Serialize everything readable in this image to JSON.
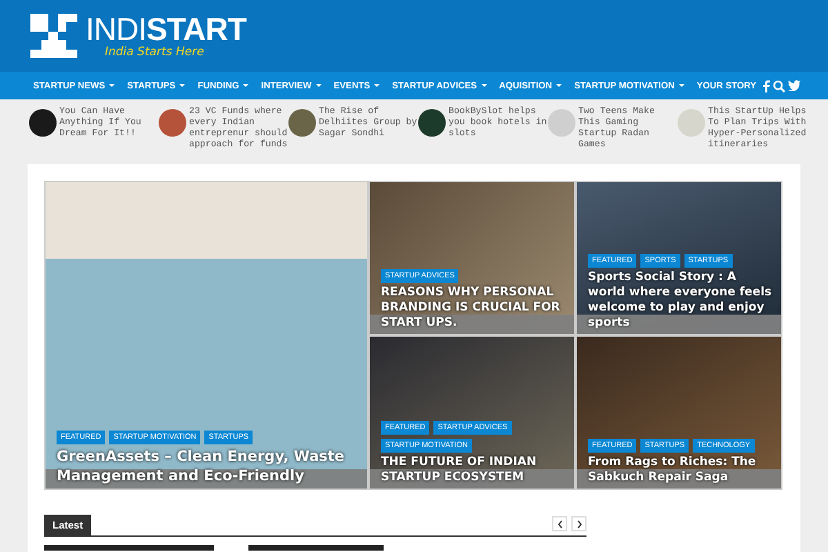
{
  "logo": {
    "name": "INDI**START**",
    "tagline": "India Starts Here"
  },
  "nav": {
    "items": [
      {
        "label": "STARTUP NEWS",
        "has_menu": true
      },
      {
        "label": "STARTUPS",
        "has_menu": true
      },
      {
        "label": "FUNDING",
        "has_menu": true
      },
      {
        "label": "INTERVIEW",
        "has_menu": true
      },
      {
        "label": "EVENTS",
        "has_menu": true
      },
      {
        "label": "STARTUP ADVICES",
        "has_menu": true
      },
      {
        "label": "AQUISITION",
        "has_menu": true
      },
      {
        "label": "STARTUP MOTIVATION",
        "has_menu": true
      },
      {
        "label": "YOUR STORY",
        "has_menu": false
      }
    ],
    "social": [
      {
        "kind": "facebook"
      },
      {
        "kind": "search"
      },
      {
        "kind": "twitter"
      }
    ]
  },
  "ticker": [
    {
      "text": "You Can Have Anything If You Dream For It!!"
    },
    {
      "text": "23 VC Funds where every Indian entreprenur should approach for funds"
    },
    {
      "text": "The Rise of Delhiites Group by Sagar Sondhi"
    },
    {
      "text": "BookBySlot helps you book hotels in slots"
    },
    {
      "text": "Two Teens Make This Gaming Startup Radan Games"
    },
    {
      "text": "This StartUp Helps To Plan Trips With Hyper-Personalized itineraries"
    }
  ],
  "featured": [
    {
      "tags": [
        "FEATURED",
        "STARTUP MOTIVATION",
        "STARTUPS"
      ],
      "title": "GreenAssets – Clean Energy, Waste Management and Eco-Friendly"
    },
    {
      "tags": [
        "STARTUP ADVICES"
      ],
      "title": "REASONS WHY PERSONAL BRANDING IS CRUCIAL FOR START UPS."
    },
    {
      "tags": [
        "FEATURED",
        "SPORTS",
        "STARTUPS"
      ],
      "title": "Sports Social Story : A world where everyone feels welcome to play and enjoy sports"
    },
    {
      "tags": [
        "FEATURED",
        "STARTUP ADVICES",
        "STARTUP MOTIVATION"
      ],
      "title": "THE FUTURE OF INDIAN STARTUP ECOSYSTEM"
    },
    {
      "tags": [
        "FEATURED",
        "STARTUPS",
        "TECHNOLOGY"
      ],
      "title": "From Rags to Riches: The Sabkuch Repair Saga"
    }
  ],
  "latest": {
    "title": "Latest"
  }
}
